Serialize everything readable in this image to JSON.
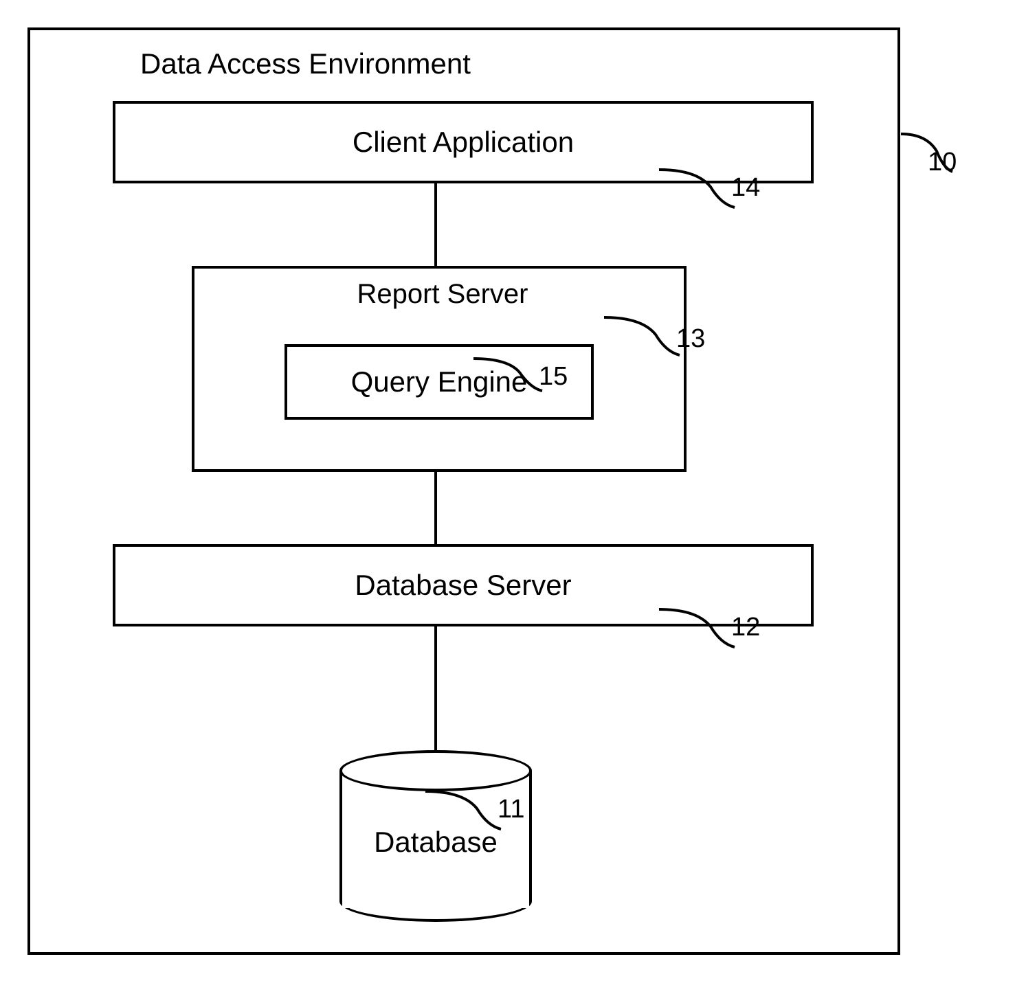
{
  "diagram": {
    "title": "Data Access Environment",
    "nodes": {
      "client_app": {
        "label": "Client Application",
        "ref": "14"
      },
      "report_server": {
        "label": "Report Server",
        "ref": "13"
      },
      "query_engine": {
        "label": "Query Engine",
        "ref": "15"
      },
      "database_server": {
        "label": "Database Server",
        "ref": "12"
      },
      "database": {
        "label": "Database",
        "ref": "11"
      }
    },
    "outer_ref": "10",
    "connections": [
      [
        "client_app",
        "report_server"
      ],
      [
        "report_server",
        "database_server"
      ],
      [
        "database_server",
        "database"
      ]
    ]
  }
}
